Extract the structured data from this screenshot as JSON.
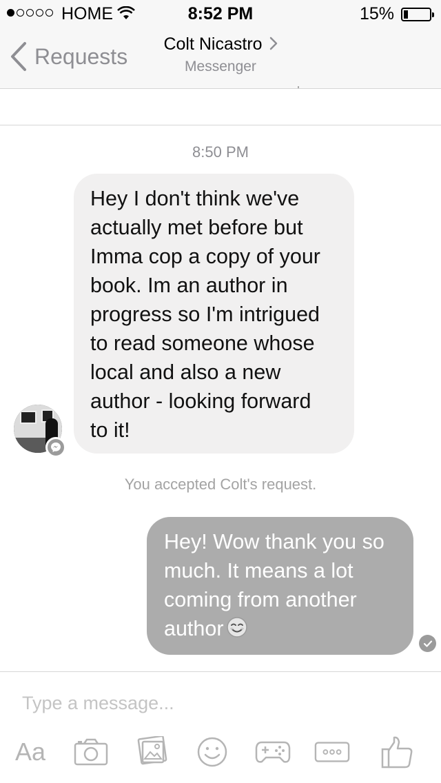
{
  "status_bar": {
    "carrier": "HOME",
    "time": "8:52 PM",
    "battery_percent": "15%",
    "battery_level": 0.15,
    "signal_bars_filled": 1,
    "signal_bars_total": 5
  },
  "nav": {
    "back_label": "Requests",
    "title": "Colt Nicastro",
    "subtitle": "Messenger"
  },
  "conversation": {
    "timestamp": "8:50 PM",
    "incoming_message": "Hey I don't think we've\nactually met before but\nImma cop a copy of your\nbook. Im an author in\nprogress so I'm intrigued\nto read someone whose\nlocal and also a new\nauthor - looking forward\nto it!",
    "system_note": "You accepted Colt's request.",
    "outgoing_message": {
      "line1": "Hey! Wow thank you so",
      "line2": "much. It means a lot",
      "line3": "coming from another",
      "line4": "author"
    }
  },
  "composer": {
    "placeholder": "Type a message...",
    "text_button": "Aa"
  },
  "icons": {
    "toolbar": [
      "text-format-icon",
      "camera-icon",
      "photo-gallery-icon",
      "emoji-icon",
      "game-controller-icon",
      "more-options-icon",
      "like-thumb-icon"
    ]
  },
  "colors": {
    "incoming_bubble": "#f1f0f0",
    "outgoing_bubble": "#acacac",
    "secondary_text": "#8e8e93"
  }
}
